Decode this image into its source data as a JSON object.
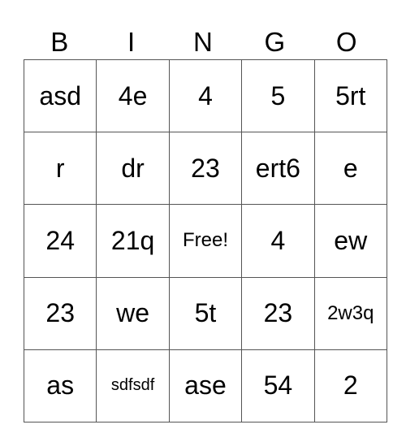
{
  "header": [
    "B",
    "I",
    "N",
    "G",
    "O"
  ],
  "rows": [
    [
      "asd",
      "4e",
      "4",
      "5",
      "5rt"
    ],
    [
      "r",
      "dr",
      "23",
      "ert6",
      "e"
    ],
    [
      "24",
      "21q",
      "Free!",
      "4",
      "ew"
    ],
    [
      "23",
      "we",
      "5t",
      "23",
      "2w3q"
    ],
    [
      "as",
      "sdfsdf",
      "ase",
      "54",
      "2"
    ]
  ]
}
